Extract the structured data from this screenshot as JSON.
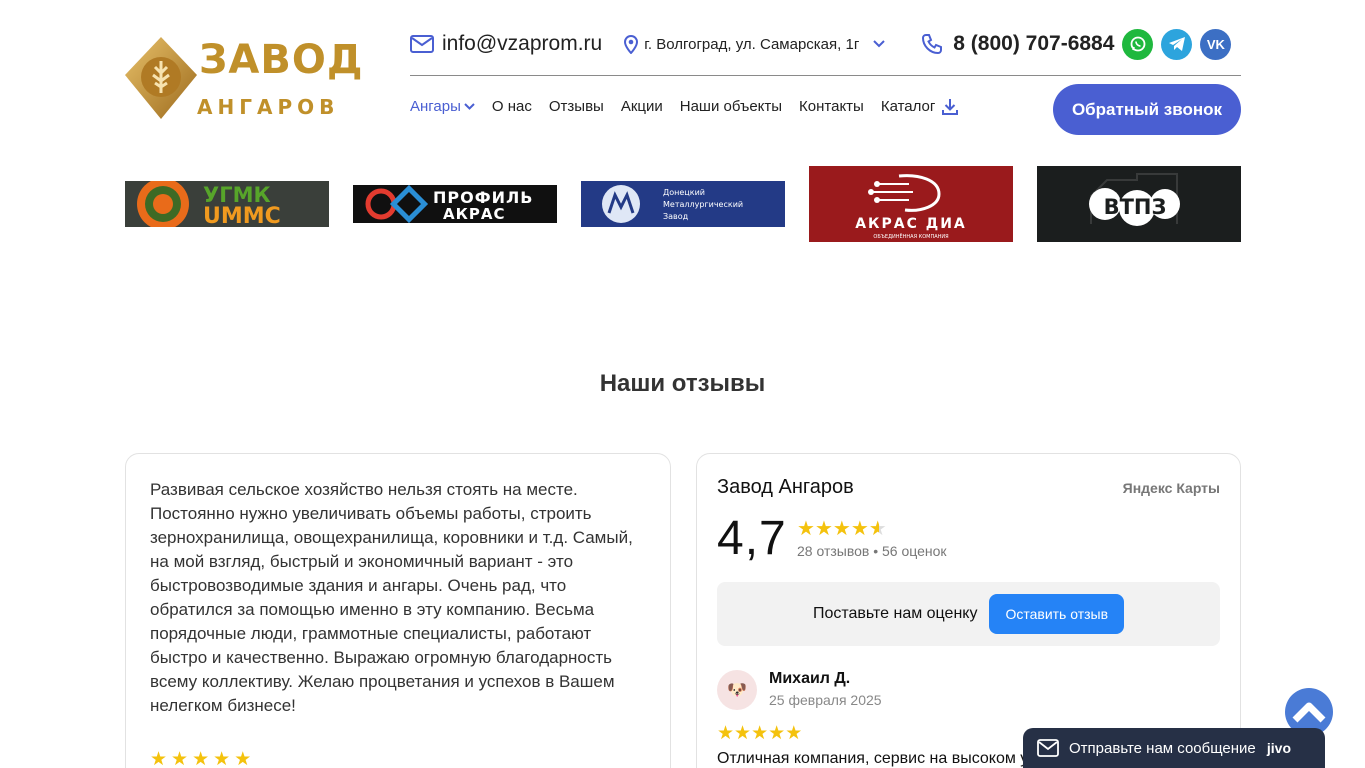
{
  "header": {
    "logo_main": "ЗАВОД",
    "logo_sub": "АНГАРОВ",
    "email": "info@vzaprom.ru",
    "address": "г. Волгоград, ул. Самарская, 1г",
    "phone": "8 (800) 707-6884",
    "social": [
      {
        "name": "whatsapp",
        "color": "#1fb83e"
      },
      {
        "name": "telegram",
        "color": "#2da4dd"
      },
      {
        "name": "vk",
        "color": "#3c6fc4"
      }
    ]
  },
  "nav": {
    "items": [
      "Ангары",
      "О нас",
      "Отзывы",
      "Акции",
      "Наши объекты",
      "Контакты",
      "Каталог"
    ],
    "callback_label": "Обратный звонок"
  },
  "partners": [
    {
      "name": "УГМК",
      "sub": "UMMC"
    },
    {
      "name": "ПРОФИЛЬ",
      "sub": "АКРАС"
    },
    {
      "name": "Донецкий",
      "sub": "Металлургический",
      "sub2": "Завод"
    },
    {
      "name": "АКРАС ДИА",
      "sub": "ОБЪЕДИНЁННАЯ КОМПАНИЯ"
    },
    {
      "name": "ВТПЗ"
    }
  ],
  "reviews_section": {
    "title": "Наши отзывы",
    "review_text": "Развивая сельское хозяйство нельзя стоять на месте. Постоянно нужно увеличивать объемы работы, строить зернохранилища, овощехранилища, коровники и т.д. Самый, на мой взгляд, быстрый и экономичный вариант - это быстровозводимые здания и ангары. Очень рад, что обратился за помощью именно в эту компанию. Весьма порядочные люди, граммотные специалисты, работают быстро и качественно. Выражаю огромную благодарность всему коллективу. Желаю процветания и успехов в Вашем нелегком бизнесе!",
    "review_rating": 5
  },
  "yandex": {
    "company": "Завод Ангаров",
    "brand": "Яндекс Карты",
    "rating": "4,7",
    "counts": "28 отзывов • 56 оценок",
    "rate_prompt": "Поставьте нам оценку",
    "leave_review": "Оставить отзыв",
    "author": "Михаил Д.",
    "date": "25 февраля 2025",
    "author_rating": 5,
    "review_snippet": "Отличная компания, сервис на высоком у"
  },
  "chat": {
    "label": "Отправьте нам сообщение",
    "brand": "jivo"
  }
}
